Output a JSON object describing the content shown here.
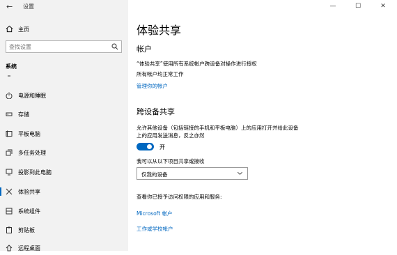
{
  "window": {
    "app_title": "设置",
    "controls": {
      "minimize": "—",
      "maximize": "☐",
      "close": "✕"
    }
  },
  "sidebar": {
    "home": "主页",
    "search_placeholder": "查找设置",
    "section": "系统",
    "items": [
      {
        "label": "电源和睡眠",
        "icon": "power-icon"
      },
      {
        "label": "存储",
        "icon": "storage-icon"
      },
      {
        "label": "平板电脑",
        "icon": "tablet-icon"
      },
      {
        "label": "多任务处理",
        "icon": "multitasking-icon"
      },
      {
        "label": "投影到此电脑",
        "icon": "project-icon"
      },
      {
        "label": "体验共享",
        "icon": "shared-experiences-icon",
        "selected": true
      },
      {
        "label": "系统组件",
        "icon": "system-components-icon"
      },
      {
        "label": "剪贴板",
        "icon": "clipboard-icon"
      },
      {
        "label": "远程桌面",
        "icon": "remote-desktop-icon"
      }
    ]
  },
  "main": {
    "title": "体验共享",
    "accounts": {
      "title": "帐户",
      "description": "“体验共享”使用所有系统帐户跨设备对操作进行授权",
      "status": "所有帐户均正常工作",
      "link": "管理你的帐户"
    },
    "cross_device": {
      "title": "跨设备共享",
      "description_line1": "允许其他设备（包括链接的手机和平板电脑）上的应用打开并给此设备",
      "description_line2": "上的应用发送消息，反之亦然",
      "toggle_state": "开",
      "toggle_on": true,
      "share_label": "我可以从以下项目共享或接收",
      "dropdown_value": "仅我的设备"
    },
    "access": {
      "heading": "查看你已授予访问权限的应用和服务:",
      "links": [
        "Microsoft 帐户",
        "工作或学校帐户"
      ]
    }
  },
  "colors": {
    "accent": "#0067c0",
    "sidebar_bg": "#f2f2f2"
  }
}
